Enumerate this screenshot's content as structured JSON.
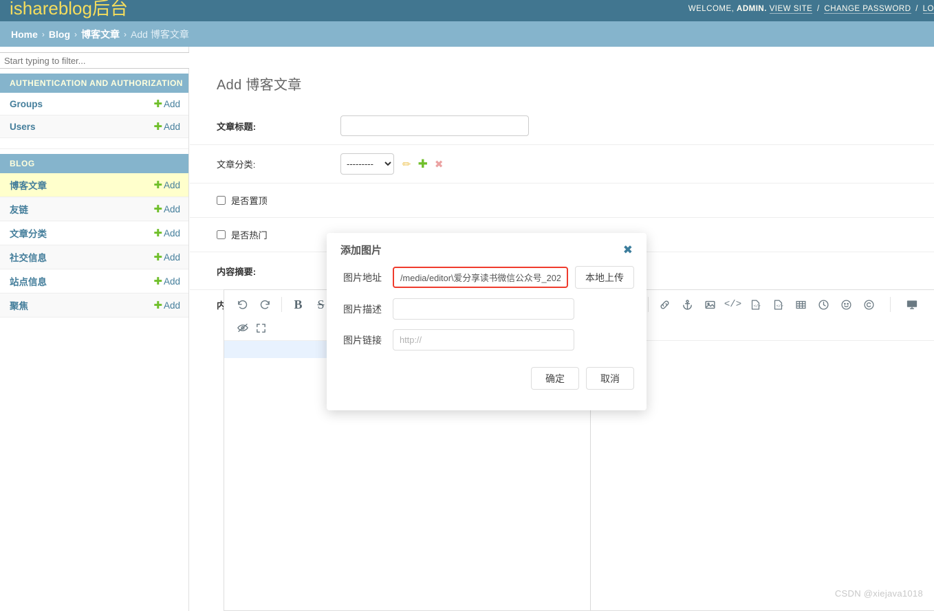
{
  "header": {
    "branding": "ishareblog后台",
    "welcome_prefix": "WELCOME,",
    "username": "ADMIN.",
    "view_site": "VIEW SITE",
    "change_password": "CHANGE PASSWORD",
    "logout": "LO",
    "separator": "/",
    "bg_color": "#417690",
    "brand_color": "#f5dd5d"
  },
  "breadcrumbs": {
    "home": "Home",
    "app": "Blog",
    "model": "博客文章",
    "current": "Add 博客文章",
    "separator": "›",
    "bg_color": "#85b4cc"
  },
  "sidebar": {
    "filter_placeholder": "Start typing to filter...",
    "filter_value": "",
    "modules": [
      {
        "caption": "AUTHENTICATION AND AUTHORIZATION",
        "models": [
          {
            "name": "Groups",
            "add_label": "Add",
            "current": false
          },
          {
            "name": "Users",
            "add_label": "Add",
            "current": false
          }
        ]
      },
      {
        "caption": "BLOG",
        "models": [
          {
            "name": "博客文章",
            "add_label": "Add",
            "current": true
          },
          {
            "name": "友链",
            "add_label": "Add",
            "current": false
          },
          {
            "name": "文章分类",
            "add_label": "Add",
            "current": false
          },
          {
            "name": "社交信息",
            "add_label": "Add",
            "current": false
          },
          {
            "name": "站点信息",
            "add_label": "Add",
            "current": false
          },
          {
            "name": "聚焦",
            "add_label": "Add",
            "current": false
          }
        ]
      }
    ]
  },
  "main": {
    "page_title": "Add 博客文章",
    "fields": {
      "title_label": "文章标题:",
      "title_value": "",
      "category_label": "文章分类:",
      "category_selected": "---------",
      "category_options": [
        "---------"
      ],
      "top_checkbox_label": "是否置顶",
      "top_checked": false,
      "hot_checkbox_label": "是否热门",
      "hot_checked": false,
      "summary_label": "内容摘要:",
      "summary_value": "",
      "content_label": "内容:"
    },
    "icon_actions": {
      "edit": "pencil-icon",
      "add": "plus-icon",
      "delete": "cross-icon"
    }
  },
  "editor": {
    "toolbar_row1": [
      "undo-icon",
      "redo-icon",
      "sep",
      "bold-icon",
      "strikethrough-icon",
      "sep-hidden",
      "link-icon",
      "anchor-icon",
      "image-icon",
      "code-inline-icon",
      "code-block-icon",
      "preformatted-code-icon",
      "table-icon",
      "datetime-icon",
      "emoji-icon",
      "copyright-icon",
      "sep",
      "watch-preview-icon",
      "hide-preview-icon",
      "fullscreen-icon"
    ],
    "toolbar_row2": [
      "page-break-icon",
      "terminal-icon",
      "sep",
      "help-icon",
      "info-icon"
    ]
  },
  "modal": {
    "title": "添加图片",
    "close_icon": "close-icon",
    "rows": [
      {
        "label": "图片地址",
        "value": "/media/editor\\爱分享读书微信公众号_202",
        "placeholder": "",
        "highlighted": true,
        "button": "本地上传"
      },
      {
        "label": "图片描述",
        "value": "",
        "placeholder": "",
        "highlighted": false,
        "button": null
      },
      {
        "label": "图片链接",
        "value": "",
        "placeholder": "http://",
        "highlighted": false,
        "button": null
      }
    ],
    "confirm_label": "确定",
    "cancel_label": "取消",
    "highlight_color": "#ef3b2d"
  },
  "watermark": {
    "text": "CSDN @xiejava1018"
  }
}
